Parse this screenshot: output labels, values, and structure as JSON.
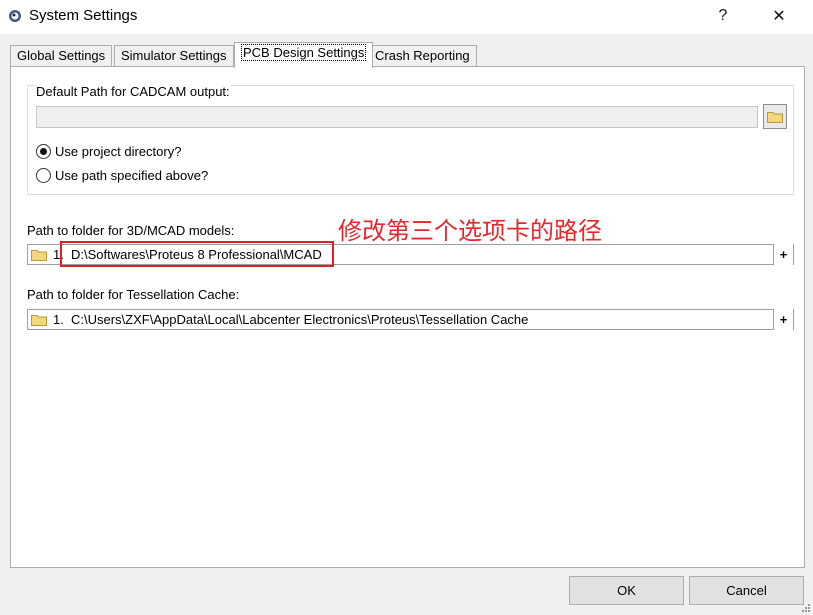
{
  "window": {
    "title": "System Settings",
    "help_label": "?",
    "close_label": "✕"
  },
  "tabs": [
    {
      "label": "Global Settings",
      "active": false
    },
    {
      "label": "Simulator Settings",
      "active": false
    },
    {
      "label": "PCB Design Settings",
      "active": true
    },
    {
      "label": "Crash Reporting",
      "active": false
    }
  ],
  "cadcam": {
    "legend": "Default Path for CADCAM output:",
    "path_value": "",
    "radio_options": [
      {
        "label": "Use project directory?",
        "checked": true
      },
      {
        "label": "Use path specified above?",
        "checked": false
      }
    ]
  },
  "mcad": {
    "label": "Path to folder for 3D/MCAD models:",
    "item_number": "1.",
    "item_path": "D:\\Softwares\\Proteus 8 Professional\\MCAD",
    "add_label": "+"
  },
  "tessellation": {
    "label": "Path to folder for Tessellation Cache:",
    "item_number": "1.",
    "item_path": "C:\\Users\\ZXF\\AppData\\Local\\Labcenter Electronics\\Proteus\\Tessellation Cache",
    "add_label": "+"
  },
  "annotation": {
    "text": "修改第三个选项卡的路径",
    "color": "#e8262b"
  },
  "buttons": {
    "ok": "OK",
    "cancel": "Cancel"
  }
}
